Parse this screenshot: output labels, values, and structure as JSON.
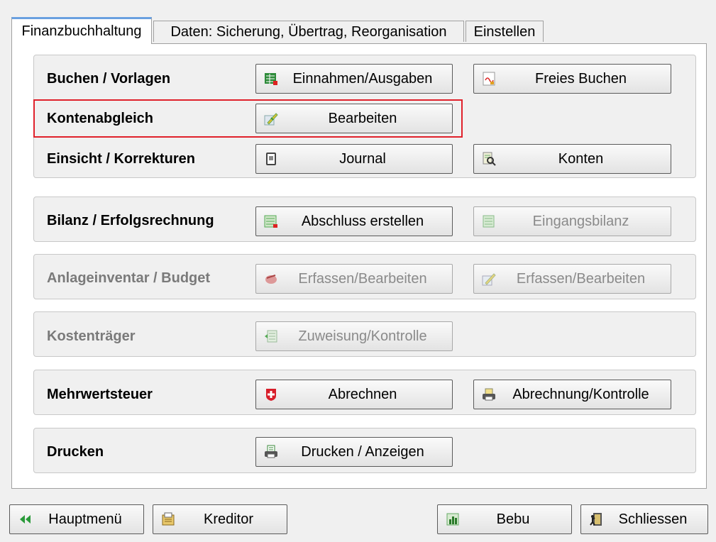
{
  "tabs": [
    "Finanzbuchhaltung",
    "Daten: Sicherung, Übertrag, Reorganisation",
    "Einstellen"
  ],
  "rows": {
    "buchen": {
      "label": "Buchen / Vorlagen",
      "btn1": "Einnahmen/Ausgaben",
      "btn2": "Freies Buchen"
    },
    "konten": {
      "label": "Kontenabgleich",
      "btn1": "Bearbeiten"
    },
    "einsicht": {
      "label": "Einsicht / Korrekturen",
      "btn1": "Journal",
      "btn2": "Konten"
    },
    "bilanz": {
      "label": "Bilanz / Erfolgsrechnung",
      "btn1": "Abschluss erstellen",
      "btn2": "Eingangsbilanz"
    },
    "anlage": {
      "label": "Anlageinventar / Budget",
      "btn1": "Erfassen/Bearbeiten",
      "btn2": "Erfassen/Bearbeiten"
    },
    "kosten": {
      "label": "Kostenträger",
      "btn1": "Zuweisung/Kontrolle"
    },
    "mwst": {
      "label": "Mehrwertsteuer",
      "btn1": "Abrechnen",
      "btn2": "Abrechnung/Kontrolle"
    },
    "drucken": {
      "label": "Drucken",
      "btn1": "Drucken / Anzeigen"
    }
  },
  "bottom": {
    "hauptmenu": "Hauptmenü",
    "kreditor": "Kreditor",
    "bebu": "Bebu",
    "schliessen": "Schliessen"
  },
  "colors": {
    "highlight": "#e0212b",
    "tab_accent": "#6aa0e0"
  }
}
